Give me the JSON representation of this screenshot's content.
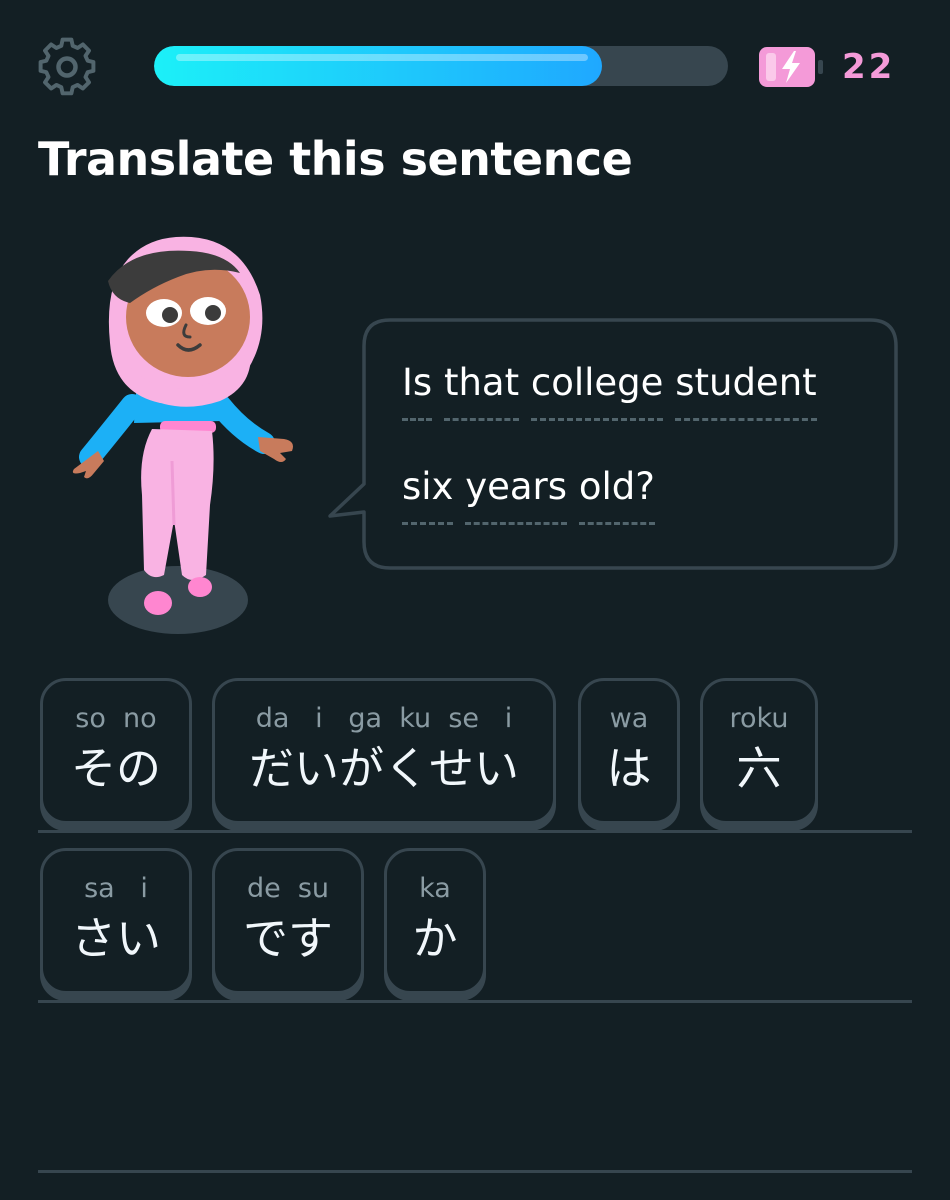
{
  "header": {
    "settings_icon": "gear-icon",
    "progress_fraction": 0.78,
    "energy_icon": "battery-lightning-icon",
    "energy_count": "22",
    "colors": {
      "energy": "#f49ad8",
      "progress_start": "#1cf0f8",
      "progress_end": "#1fa8ff"
    }
  },
  "title": "Translate this sentence",
  "prompt": {
    "line1": [
      "Is",
      "that",
      "college",
      "student"
    ],
    "line2": [
      "six",
      "years",
      "old?"
    ]
  },
  "word_bank": [
    {
      "romaji": "so  no",
      "kana": "その"
    },
    {
      "romaji": "da   i   ga  ku  se   i",
      "kana": "だいがくせい"
    },
    {
      "romaji": "wa",
      "kana": "は"
    },
    {
      "romaji": "roku",
      "kana": "六"
    },
    {
      "romaji": "sa   i",
      "kana": "さい"
    },
    {
      "romaji": "de  su",
      "kana": "です"
    },
    {
      "romaji": "ka",
      "kana": "か"
    }
  ]
}
